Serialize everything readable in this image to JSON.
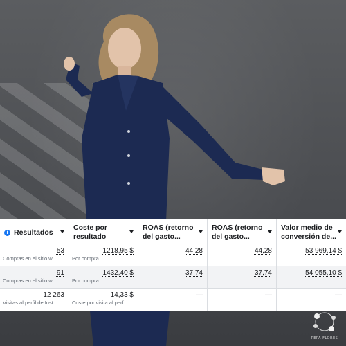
{
  "table": {
    "columns": [
      {
        "label_line1": "Resultados",
        "label_line2": "",
        "has_info": true
      },
      {
        "label_line1": "Coste por",
        "label_line2": "resultado",
        "has_info": false
      },
      {
        "label_line1": "ROAS (retorno",
        "label_line2": "del gasto...",
        "has_info": false
      },
      {
        "label_line1": "ROAS (retorno",
        "label_line2": "del gasto...",
        "has_info": false
      },
      {
        "label_line1": "Valor medio de",
        "label_line2": "conversión de...",
        "has_info": false
      }
    ],
    "rows": [
      {
        "resultados": {
          "value": "53",
          "sub": "Compras en el sitio w..."
        },
        "coste": {
          "value": "1218,95 $",
          "sub": "Por compra"
        },
        "roas1": "44,28",
        "roas2": "44,28",
        "valor": "53 969,14 $"
      },
      {
        "resultados": {
          "value": "91",
          "sub": "Compras en el sitio w..."
        },
        "coste": {
          "value": "1432,40 $",
          "sub": "Por compra"
        },
        "roas1": "37,74",
        "roas2": "37,74",
        "valor": "54 055,10 $"
      },
      {
        "resultados": {
          "value": "12 263",
          "sub": "Visitas al perfil de Inst..."
        },
        "coste": {
          "value": "14,33 $",
          "sub": "Coste por visita al perf..."
        },
        "roas1": "—",
        "roas2": "—",
        "valor": "—"
      }
    ]
  },
  "watermark": {
    "text": "PEPA FLORES",
    "icon": "floral-wreath-icon"
  },
  "colors": {
    "accent": "#1877f2",
    "border": "#dadde1",
    "pajama": "#1c2a52"
  }
}
